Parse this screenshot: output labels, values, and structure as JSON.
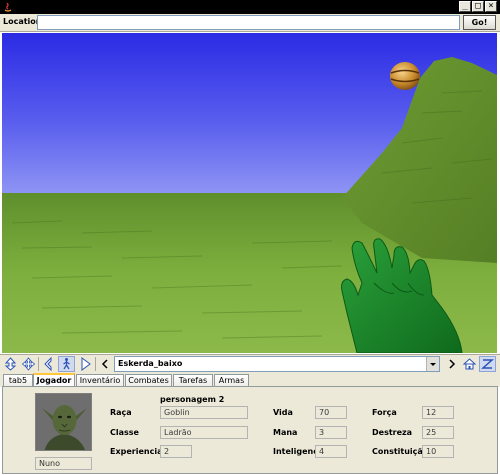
{
  "window": {
    "minimize_glyph": "_",
    "maximize_glyph": "□",
    "close_glyph": "×"
  },
  "location": {
    "label": "Location:",
    "value": "",
    "go_label": "Go!"
  },
  "toolbar": {
    "viewpoint": "Eskerda_baixo",
    "icons": [
      "move-updown-icon",
      "pan-icon",
      "turn-icon",
      "walk-icon",
      "examine-icon",
      "previous-viewpoint-icon",
      "next-viewpoint-icon",
      "home-icon",
      "straighten-icon"
    ]
  },
  "tabs": [
    {
      "label": "tab5",
      "active": false
    },
    {
      "label": "Jogador",
      "active": true
    },
    {
      "label": "Inventário",
      "active": false
    },
    {
      "label": "Combates",
      "active": false
    },
    {
      "label": "Tarefas",
      "active": false
    },
    {
      "label": "Armas",
      "active": false
    }
  ],
  "character": {
    "title": "personagem 2",
    "name": "Nuno",
    "stats": {
      "raca": {
        "label": "Raça",
        "value": "Goblin"
      },
      "classe": {
        "label": "Classe",
        "value": "Ladrão"
      },
      "experiencia": {
        "label": "Experiencia",
        "value": "2"
      },
      "vida": {
        "label": "Vida",
        "value": "70"
      },
      "mana": {
        "label": "Mana",
        "value": "3"
      },
      "inteligencia": {
        "label": "Inteligencia",
        "value": "4"
      },
      "forca": {
        "label": "Força",
        "value": "12"
      },
      "destreza": {
        "label": "Destreza",
        "value": "25"
      },
      "constituicao": {
        "label": "Constituição",
        "value": "10"
      }
    }
  },
  "colors": {
    "sky_top": "#2d2de6",
    "sky_bottom": "#8f95f5",
    "grass": "#74a83a",
    "hand": "#1f8a2c",
    "tab_highlight": "#ffc83c"
  }
}
